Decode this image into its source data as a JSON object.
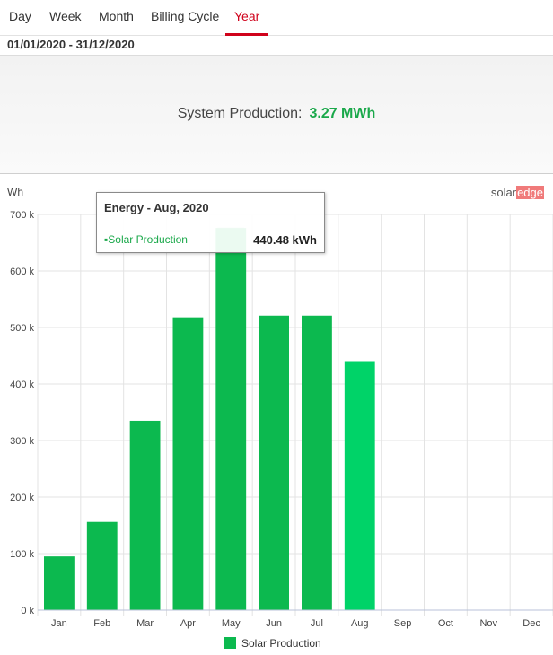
{
  "tabs": [
    {
      "label": "Day"
    },
    {
      "label": "Week"
    },
    {
      "label": "Month"
    },
    {
      "label": "Billing Cycle"
    },
    {
      "label": "Year",
      "active": true
    }
  ],
  "date_range": "01/01/2020 - 31/12/2020",
  "summary": {
    "label": "System Production:",
    "value": "3.27 MWh",
    "value_color": "#1aa84a"
  },
  "chart": {
    "unit_label": "Wh",
    "logo": {
      "part1": "solar",
      "part2": "edge"
    }
  },
  "tooltip": {
    "title": "Energy - Aug, 2020",
    "series_label": "Solar Production",
    "value": "440.48 kWh"
  },
  "legend": {
    "label": "Solar Production"
  },
  "chart_data": {
    "type": "bar",
    "categories": [
      "Jan",
      "Feb",
      "Mar",
      "Apr",
      "May",
      "Jun",
      "Jul",
      "Aug",
      "Sep",
      "Oct",
      "Nov",
      "Dec"
    ],
    "series": [
      {
        "name": "Solar Production",
        "values": [
          95000,
          156000,
          335000,
          518000,
          676000,
          521000,
          521000,
          440480,
          null,
          null,
          null,
          null
        ],
        "color": "#0cb94f",
        "highlight_color": "#00d368"
      }
    ],
    "highlighted_index": 7,
    "hover_band_index": 4,
    "y_ticks": [
      0,
      100000,
      200000,
      300000,
      400000,
      500000,
      600000,
      700000
    ],
    "y_tick_labels": [
      "0 k",
      "100 k",
      "200 k",
      "300 k",
      "400 k",
      "500 k",
      "600 k",
      "700 k"
    ],
    "ylim": [
      0,
      700000
    ],
    "ylabel": "Wh",
    "grid": true
  }
}
